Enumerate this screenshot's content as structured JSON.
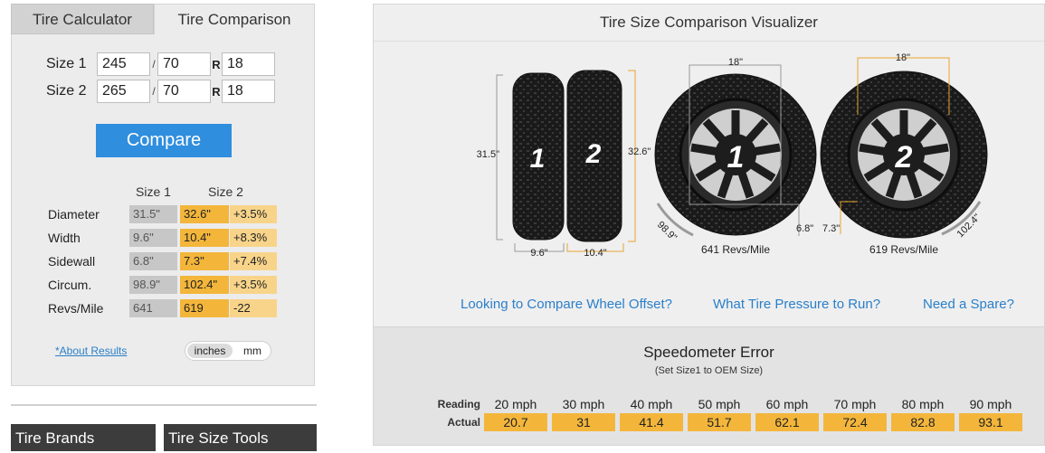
{
  "tabs": {
    "calculator": "Tire Calculator",
    "comparison": "Tire Comparison"
  },
  "inputs": {
    "size1": {
      "label": "Size 1",
      "width": "245",
      "aspect": "70",
      "rim": "18"
    },
    "size2": {
      "label": "Size 2",
      "width": "265",
      "aspect": "70",
      "rim": "18"
    },
    "slash": "/",
    "r": "R"
  },
  "compare_label": "Compare",
  "results": {
    "col1": "Size 1",
    "col2": "Size 2",
    "rows": [
      {
        "name": "Diameter",
        "v1": "31.5\"",
        "v2": "32.6\"",
        "diff": "+3.5%"
      },
      {
        "name": "Width",
        "v1": "9.6\"",
        "v2": "10.4\"",
        "diff": "+8.3%"
      },
      {
        "name": "Sidewall",
        "v1": "6.8\"",
        "v2": "7.3\"",
        "diff": "+7.4%"
      },
      {
        "name": "Circum.",
        "v1": "98.9\"",
        "v2": "102.4\"",
        "diff": "+3.5%"
      },
      {
        "name": "Revs/Mile",
        "v1": "641",
        "v2": "619",
        "diff": "-22"
      }
    ]
  },
  "about_link": "*About Results",
  "units": {
    "selected": "inches",
    "other": "mm"
  },
  "bottom_buttons": {
    "brands": "Tire Brands",
    "tools": "Tire Size Tools"
  },
  "viz": {
    "title": "Tire Size Comparison Visualizer",
    "tire1": {
      "num": "1",
      "height": "31.5\"",
      "width": "9.6\"",
      "rim": "18\"",
      "sidewall": "6.8\"",
      "circ": "98.9\"",
      "revs": "641 Revs/Mile"
    },
    "tire2": {
      "num": "2",
      "height": "32.6\"",
      "width": "10.4\"",
      "rim": "18\"",
      "sidewall": "7.3\"",
      "circ": "102.4\"",
      "revs": "619 Revs/Mile"
    },
    "colors": {
      "tire1_dim": "#9a9a9a",
      "tire2_dim": "#e8a532"
    }
  },
  "links": {
    "offset": "Looking to Compare Wheel Offset?",
    "pressure": "What Tire Pressure to Run?",
    "spare": "Need a Spare?"
  },
  "speedometer": {
    "title": "Speedometer Error",
    "subtitle": "(Set Size1 to OEM Size)",
    "reading_label": "Reading",
    "actual_label": "Actual",
    "readings": [
      "20 mph",
      "30 mph",
      "40 mph",
      "50 mph",
      "60 mph",
      "70 mph",
      "80 mph",
      "90 mph"
    ],
    "actuals": [
      "20.7",
      "31",
      "41.4",
      "51.7",
      "62.1",
      "72.4",
      "82.8",
      "93.1"
    ]
  }
}
